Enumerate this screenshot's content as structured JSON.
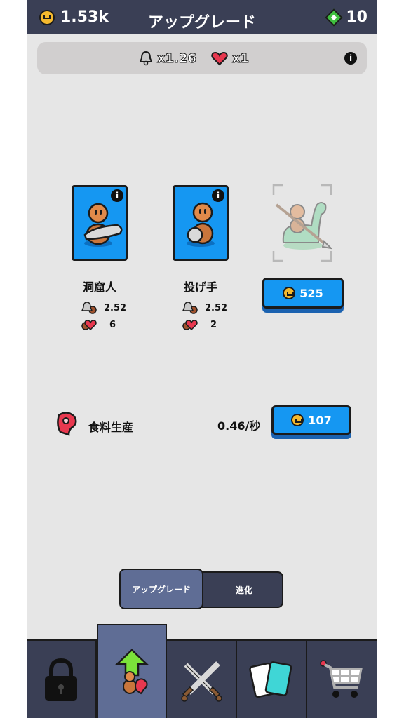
{
  "topbar": {
    "coins": "1.53k",
    "title": "アップグレード",
    "gems": "10"
  },
  "multipliers": {
    "bell": "x1.26",
    "heart": "x1"
  },
  "units": [
    {
      "name": "洞窟人",
      "bell": "2.52",
      "heart": "6"
    },
    {
      "name": "投げ手",
      "bell": "2.52",
      "heart": "2"
    }
  ],
  "locked_unit": {
    "cost": "525"
  },
  "food": {
    "label": "食料生産",
    "rate": "0.46/秒",
    "cost": "107"
  },
  "toggle": {
    "upgrade": "アップグレード",
    "evolve": "進化"
  },
  "colors": {
    "card_blue": "#1597f2",
    "dark_bar": "#3a3f55",
    "active_tab": "#5f6d95"
  },
  "icons": [
    "crown-coin-icon",
    "gem-icon",
    "bell-icon",
    "heart-icon",
    "info-icon",
    "meat-icon",
    "lock-icon",
    "upgrade-arrow-icon",
    "crossed-swords-icon",
    "cards-icon",
    "cart-icon"
  ]
}
